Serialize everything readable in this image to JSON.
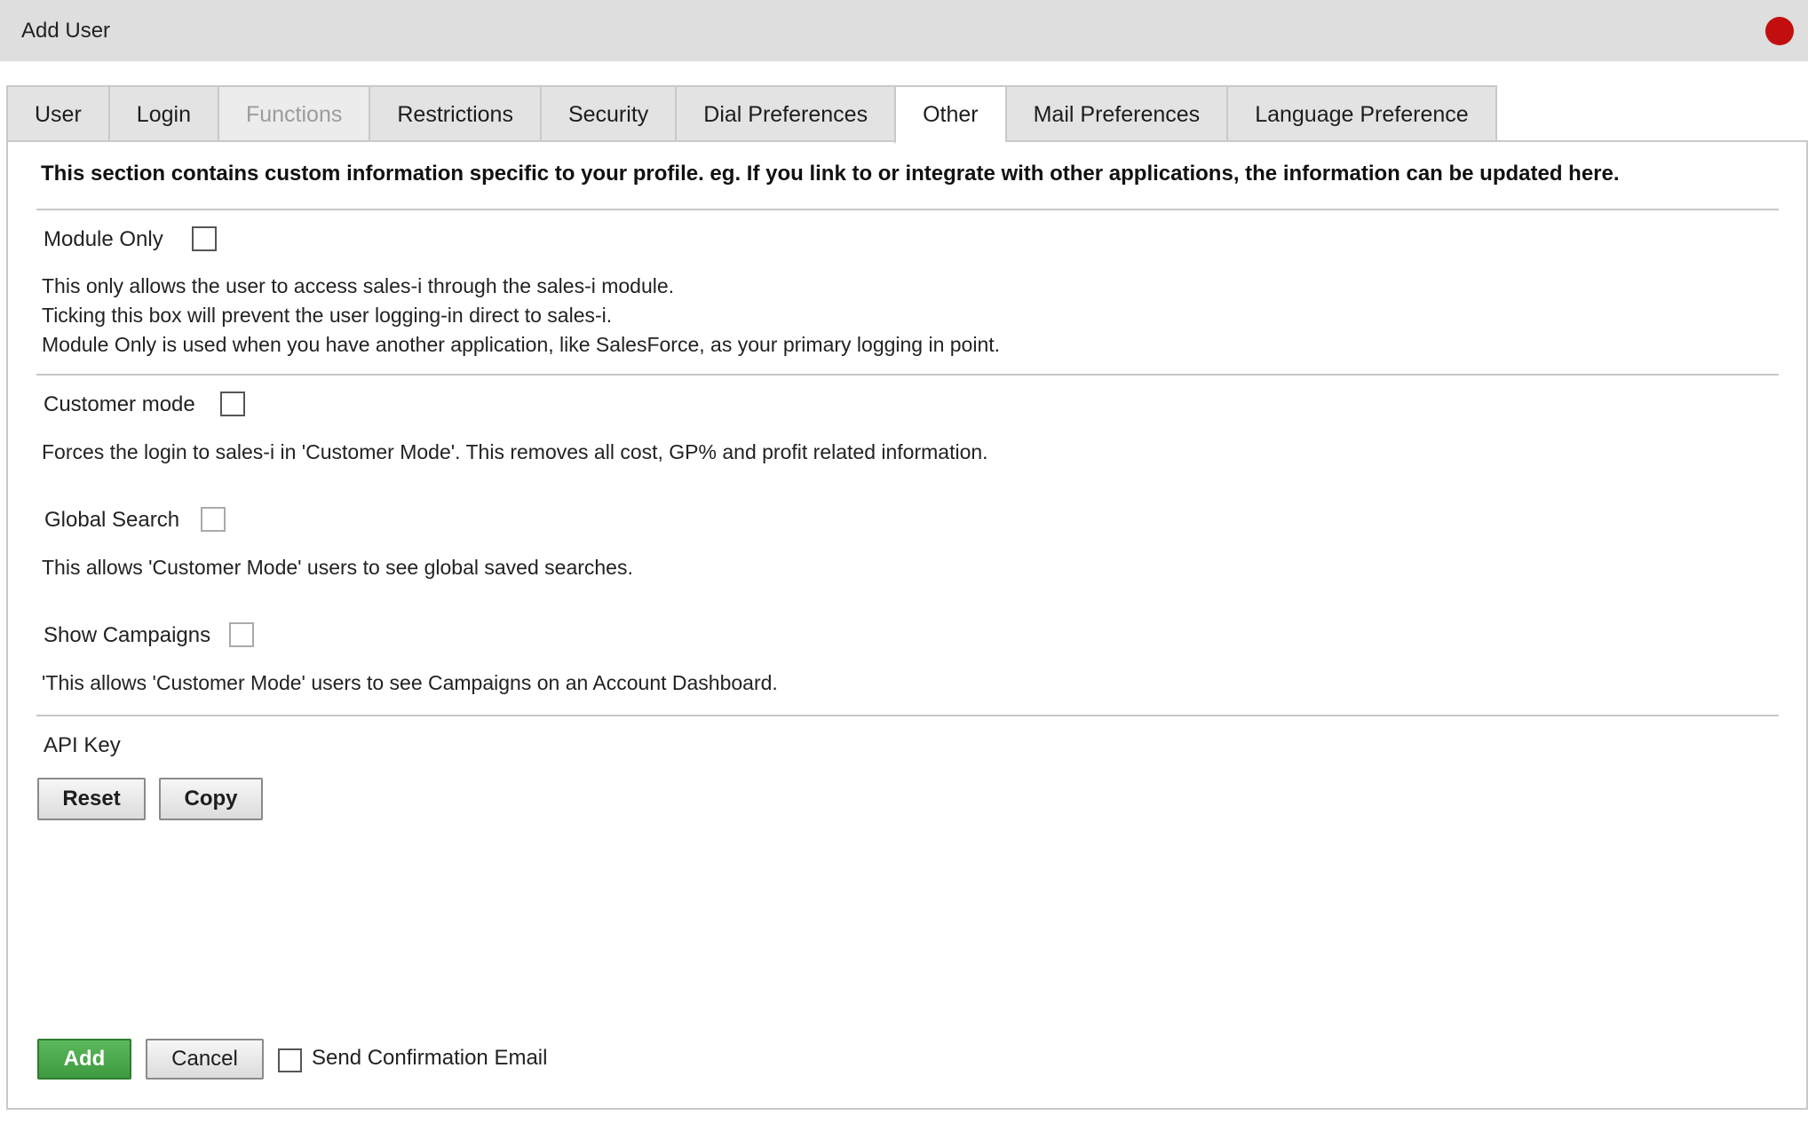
{
  "window": {
    "title": "Add User",
    "close_color": "#c20e0e",
    "close_icon": "close-dot-icon"
  },
  "tabs": [
    {
      "label": "User",
      "state": "normal"
    },
    {
      "label": "Login",
      "state": "normal"
    },
    {
      "label": "Functions",
      "state": "disabled"
    },
    {
      "label": "Restrictions",
      "state": "normal"
    },
    {
      "label": "Security",
      "state": "normal"
    },
    {
      "label": "Dial Preferences",
      "state": "normal"
    },
    {
      "label": "Other",
      "state": "active"
    },
    {
      "label": "Mail Preferences",
      "state": "normal"
    },
    {
      "label": "Language Preference",
      "state": "normal"
    }
  ],
  "intro": "This section contains custom information specific to your profile. eg. If you link to or integrate with other applications, the information can be updated here.",
  "module_only": {
    "label": "Module Only",
    "checked": false,
    "desc": [
      "This only allows the user to access sales-i through the sales-i module.",
      "Ticking this box will prevent the user logging-in direct to sales-i.",
      "Module Only is used when you have another application, like SalesForce, as your primary logging in point."
    ]
  },
  "customer_mode": {
    "label": "Customer mode",
    "checked": false,
    "desc": "Forces the login to sales-i in 'Customer Mode'. This removes all cost, GP% and profit related information."
  },
  "global_search": {
    "label": "Global Search",
    "checked": false,
    "desc": "This allows 'Customer Mode' users to see global saved searches."
  },
  "show_campaigns": {
    "label": "Show Campaigns",
    "checked": false,
    "desc": "'This allows 'Customer Mode' users to see Campaigns on an Account Dashboard."
  },
  "api_key": {
    "label": "API Key",
    "reset_label": "Reset",
    "copy_label": "Copy"
  },
  "footer": {
    "add_label": "Add",
    "cancel_label": "Cancel",
    "send_email_label": "Send Confirmation Email",
    "send_email_checked": false,
    "add_color": "#4cae4c"
  }
}
